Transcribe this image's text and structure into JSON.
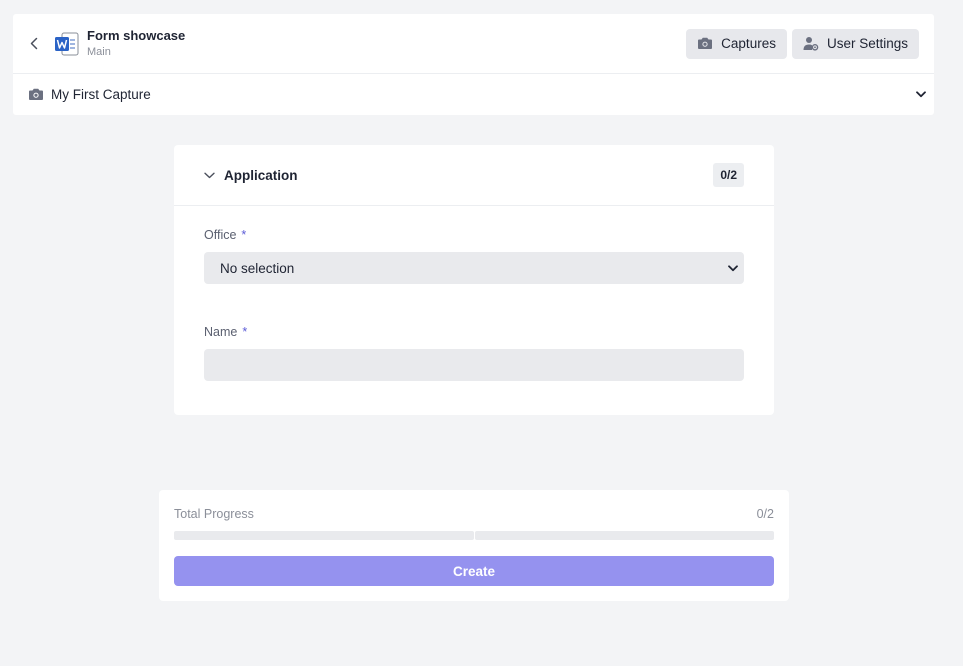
{
  "header": {
    "title": "Form showcase",
    "subtitle": "Main",
    "captures_label": "Captures",
    "user_settings_label": "User Settings"
  },
  "capture_bar": {
    "name": "My First Capture"
  },
  "section": {
    "title": "Application",
    "count": "0/2",
    "fields": [
      {
        "label": "Office",
        "required_mark": "*",
        "value": "No selection"
      },
      {
        "label": "Name",
        "required_mark": "*",
        "value": ""
      }
    ]
  },
  "progress": {
    "label": "Total Progress",
    "count": "0/2",
    "completed": 0,
    "total": 2
  },
  "actions": {
    "create_label": "Create"
  },
  "colors": {
    "accent": "#9592ef",
    "required": "#5b5bd6",
    "background": "#f3f4f6"
  }
}
